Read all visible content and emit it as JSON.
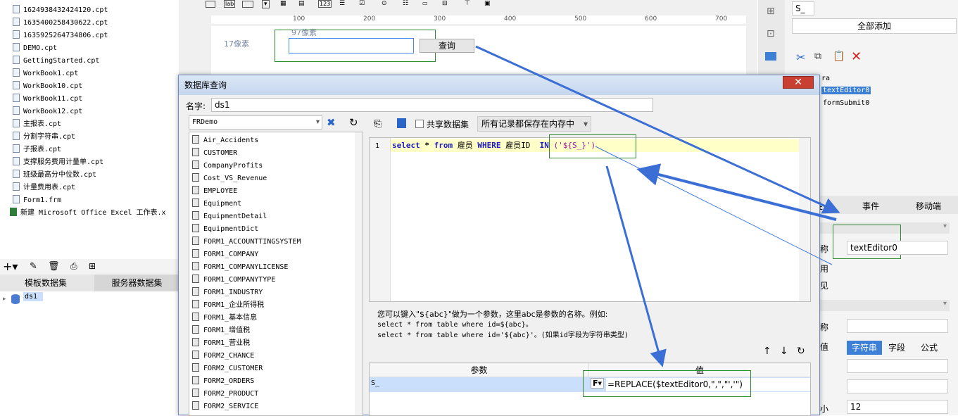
{
  "files": [
    "1624938432424120.cpt",
    "1635400258430622.cpt",
    "1635925264734806.cpt",
    "DEMO.cpt",
    "GettingStarted.cpt",
    "WorkBook1.cpt",
    "WorkBook10.cpt",
    "WorkBook11.cpt",
    "WorkBook12.cpt",
    "主报表.cpt",
    "分割字符串.cpt",
    "子报表.cpt",
    "支撑服务费用计量单.cpt",
    "班级最高分中位数.cpt",
    "计量费用表.cpt",
    "Form1.frm",
    "新建 Microsoft Office Excel 工作表.x"
  ],
  "dataset_tabs": {
    "template": "模板数据集",
    "server": "服务器数据集"
  },
  "dataset_tree": {
    "item": "ds1"
  },
  "designer": {
    "ruler_ticks": [
      "100",
      "200",
      "300",
      "400",
      "500",
      "600",
      "700"
    ],
    "row_height_label": "17像素",
    "top_label": "97像素",
    "query_button": "查询"
  },
  "right_panel": {
    "top_input": "S_",
    "add_all_button": "全部添加",
    "tree_items": [
      "ra",
      "textEditor0",
      "formSubmit0"
    ],
    "prop_tabs": [
      "性",
      "事件",
      "移动端"
    ],
    "name_label": "称",
    "name_value": "textEditor0",
    "label_use": "用",
    "label_see": "见",
    "label_name2": "称",
    "label_value": "值",
    "type_buttons": [
      "字符串",
      "字段",
      "公式"
    ],
    "size_label": "小",
    "size_value": "12"
  },
  "dialog": {
    "title": "数据库查询",
    "close": "✕",
    "name_label": "名字:",
    "name_value": "ds1",
    "connection": "FRDemo",
    "share_dataset": "共享数据集",
    "storage_option": "所有记录都保存在内存中",
    "sql_line_number": "1",
    "sql": {
      "kw1": "select",
      "star": " * ",
      "kw2": "from",
      "table": " 雇员 ",
      "kw3": "WHERE",
      "col": " 雇员ID  ",
      "kw4": "IN",
      "param": " ('${S_}')"
    },
    "tables": [
      "Air_Accidents",
      "CUSTOMER",
      "CompanyProfits",
      "Cost_VS_Revenue",
      "EMPLOYEE",
      "Equipment",
      "EquipmentDetail",
      "EquipmentDict",
      "FORM1_ACCOUNTTINGSYSTEM",
      "FORM1_COMPANY",
      "FORM1_COMPANYLICENSE",
      "FORM1_COMPANYTYPE",
      "FORM1_INDUSTRY",
      "FORM1_企业所得税",
      "FORM1_基本信息",
      "FORM1_增值税",
      "FORM1_营业税",
      "FORM2_CHANCE",
      "FORM2_CUSTOMER",
      "FORM2_ORDERS",
      "FORM2_PRODUCT",
      "FORM2_SERVICE"
    ],
    "help_lines": [
      "您可以键入\"${abc}\"做为一个参数，这里abc是参数的名称。例如:",
      "select * from table where id=${abc}。",
      "select * from table where id='${abc}'。(如果id字段为字符串类型)"
    ],
    "param_table": {
      "headers": [
        "参数",
        "值"
      ],
      "row": {
        "param": "S_",
        "value": "=REPLACE($textEditor0,\",\",\"','\")"
      }
    }
  },
  "colors": {
    "accent": "#3b6fd6",
    "highlight_box": "#2e8b2e",
    "selected": "#c9dffb",
    "sql_row": "#ffffc8"
  }
}
